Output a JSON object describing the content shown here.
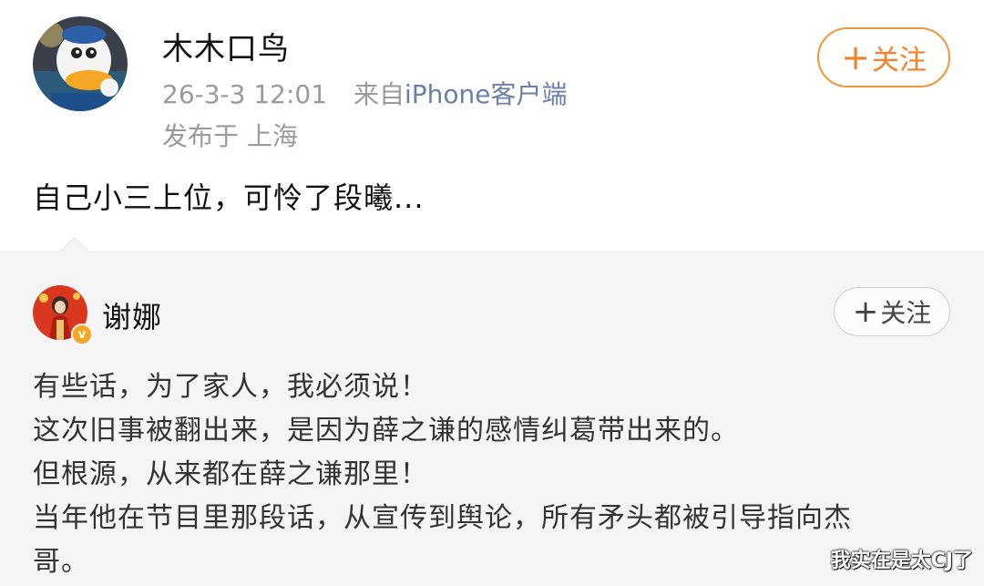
{
  "post": {
    "username": "木木口鸟",
    "time": "26-3-3 12:01",
    "source_prefix": "来自",
    "source_device": "iPhone客户端",
    "location": "发布于 上海",
    "follow_label": "关注",
    "text": "自己小三上位，可怜了段曦..."
  },
  "repost": {
    "username": "谢娜",
    "follow_label": "关注",
    "lines": [
      "有些话，为了家人，我必须说！",
      "这次旧事被翻出来，是因为薛之谦的感情纠葛带出来的。",
      "但根源，从来都在薛之谦那里！",
      "当年他在节目里那段话，从宣传到舆论，所有矛头都被引导指向杰",
      "哥。"
    ]
  },
  "watermark": "我实在是太CJ了",
  "colors": {
    "follow_accent": "#f2822a",
    "link_blue": "#6b7fa8",
    "repost_bg": "#f5f5f5",
    "verified": "#f5a623"
  },
  "icons": {
    "follow_plus": "plus-icon",
    "verified": "verified-badge-icon"
  }
}
